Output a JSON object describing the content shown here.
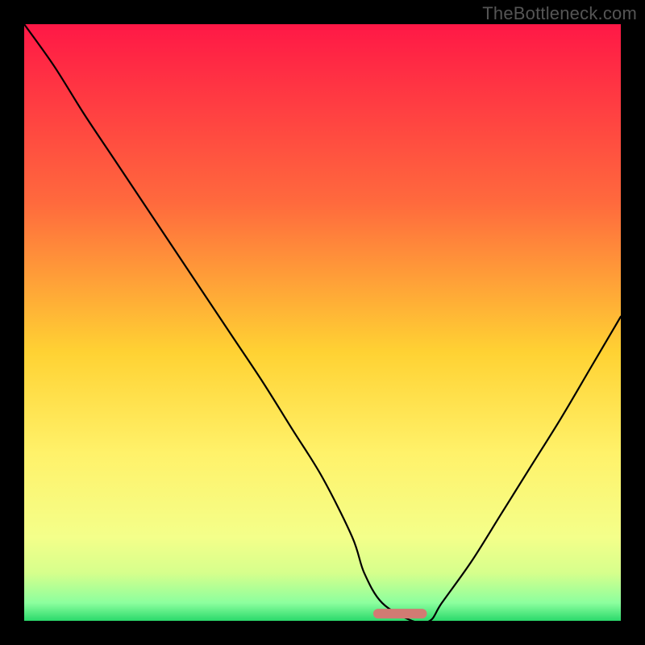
{
  "watermark": "TheBottleneck.com",
  "chart_data": {
    "type": "line",
    "title": "",
    "xlabel": "",
    "ylabel": "",
    "xlim": [
      0,
      100
    ],
    "ylim": [
      0,
      100
    ],
    "x": [
      0,
      5,
      10,
      15,
      20,
      25,
      30,
      35,
      40,
      45,
      50,
      55,
      57,
      60,
      65,
      68,
      70,
      75,
      80,
      85,
      90,
      95,
      100
    ],
    "values": [
      100,
      93,
      85,
      77.5,
      70,
      62.5,
      55,
      47.5,
      40,
      32,
      24,
      14,
      8,
      3,
      0,
      0,
      3,
      10,
      18,
      26,
      34,
      42.5,
      51
    ],
    "annotations": [
      {
        "shape": "capsule",
        "x_start": 58.5,
        "x_end": 67.5,
        "y": 1.2,
        "color": "#d17b73"
      }
    ],
    "background": {
      "type": "vertical-gradient",
      "stops": [
        {
          "pct": 0,
          "color": "#ff1846"
        },
        {
          "pct": 30,
          "color": "#ff6a3d"
        },
        {
          "pct": 55,
          "color": "#ffd233"
        },
        {
          "pct": 72,
          "color": "#fff26a"
        },
        {
          "pct": 86,
          "color": "#f4ff8a"
        },
        {
          "pct": 92,
          "color": "#d6ff8c"
        },
        {
          "pct": 97,
          "color": "#8cff9e"
        },
        {
          "pct": 100,
          "color": "#2bd96b"
        }
      ]
    }
  }
}
